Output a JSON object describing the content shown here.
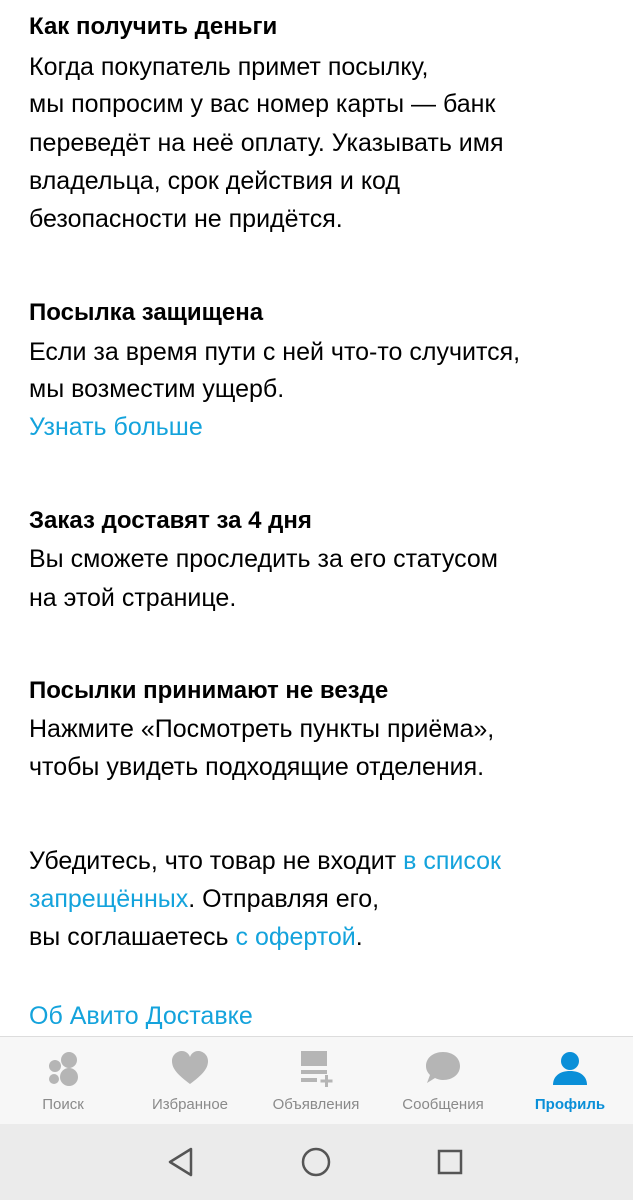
{
  "sections": {
    "money": {
      "title": "Как получить деньги",
      "lines": [
        "Когда покупатель примет посылку,",
        "мы попросим у вас номер карты — банк",
        "переведёт на неё оплату. Указывать имя",
        "владельца, срок действия и код",
        "безопасности не придётся."
      ]
    },
    "protected": {
      "title": "Посылка защищена",
      "lines": [
        "Если за время пути с ней что-то случится,",
        "мы возместим ущерб."
      ],
      "link": "Узнать больше"
    },
    "delivery": {
      "title": "Заказ доставят за 4 дня",
      "lines": [
        "Вы сможете проследить за его статусом",
        "на этой странице."
      ]
    },
    "points": {
      "title": "Посылки принимают не везде",
      "lines": [
        "Нажмите «Посмотреть пункты приёма»,",
        "чтобы увидеть подходящие отделения."
      ]
    },
    "notice": {
      "line1_text": "Убедитесь, что товар не входит ",
      "line1_link": "в список",
      "line2_link": "запрещённых",
      "line2_text": ". Отправляя его,",
      "line3_text": "вы соглашаетесь ",
      "line3_link": "с офертой",
      "line3_end": "."
    },
    "about_link": "Об Авито Доставке"
  },
  "tabbar": {
    "items": [
      {
        "label": "Поиск",
        "icon": "search-bubbles-icon",
        "active": false
      },
      {
        "label": "Избранное",
        "icon": "heart-icon",
        "active": false
      },
      {
        "label": "Объявления",
        "icon": "ads-list-add-icon",
        "active": false
      },
      {
        "label": "Сообщения",
        "icon": "chat-bubble-icon",
        "active": false
      },
      {
        "label": "Профиль",
        "icon": "profile-icon",
        "active": true
      }
    ]
  },
  "colors": {
    "link": "#14a3dc",
    "tab_inactive": "#8a8a8a",
    "tab_active": "#0a8fd8",
    "icon_inactive": "#b5b5b5"
  },
  "navbar": {
    "buttons": [
      "back-icon",
      "home-icon",
      "recents-icon"
    ]
  }
}
